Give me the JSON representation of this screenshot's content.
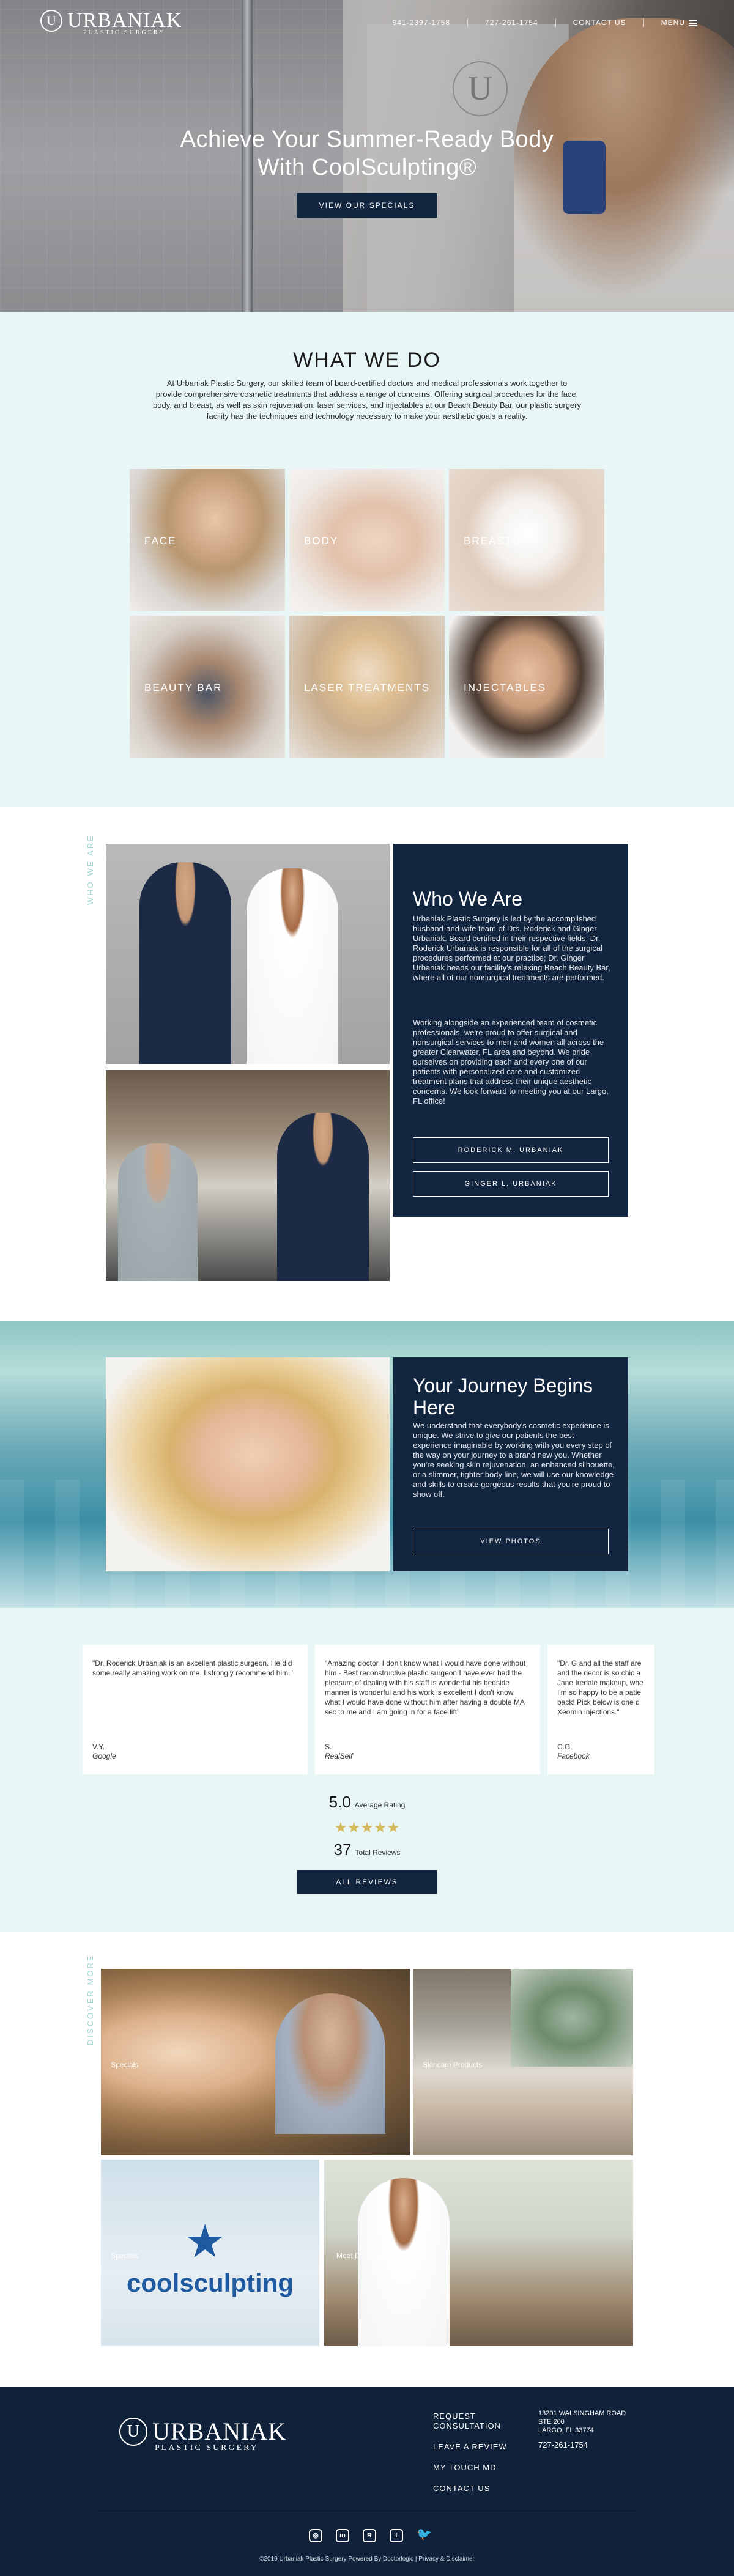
{
  "brand": {
    "logo_letter": "U",
    "name": "URBANIAK",
    "subtitle": "PLASTIC SURGERY"
  },
  "topnav": {
    "phone1": "941-2397-1758",
    "phone2": "727-261-1754",
    "contact": "CONTACT US",
    "menu": "MENU"
  },
  "hero": {
    "headline_line1": "Achieve Your Summer-Ready Body",
    "headline_line2": "With CoolSculpting®",
    "button": "VIEW OUR SPECIALS",
    "glass_logo_letter": "U"
  },
  "what_we_do": {
    "title": "WHAT WE DO",
    "text": "At Urbaniak Plastic Surgery, our skilled team of board-certified doctors and medical professionals work together to provide comprehensive cosmetic treatments that address a range of concerns. Offering surgical procedures for the face, body, and breast, as well as skin rejuvenation, laser services, and injectables at our Beach Beauty Bar, our plastic surgery facility has the techniques and technology necessary to make your aesthetic goals a reality.",
    "tiles": [
      "FACE",
      "BODY",
      "BREASTS",
      "BEAUTY BAR",
      "LASER TREATMENTS",
      "INJECTABLES"
    ]
  },
  "who_we_are": {
    "side_label": "WHO WE ARE",
    "title": "Who We Are",
    "para1": "Urbaniak Plastic Surgery is led by the accomplished husband-and-wife team of Drs. Roderick and Ginger Urbaniak. Board certified in their respective fields, Dr. Roderick Urbaniak is responsible for all of the surgical procedures performed at our practice; Dr. Ginger Urbaniak heads our facility's relaxing Beach Beauty Bar, where all of our nonsurgical treatments are performed.",
    "para2": "Working alongside an experienced team of cosmetic professionals, we're proud to offer surgical and nonsurgical services to men and women all across the greater Clearwater, FL area and beyond. We pride ourselves on providing each and every one of our patients with personalized care and customized treatment plans that address their unique aesthetic concerns. We look forward to meeting you at our Largo, FL office!",
    "button1": "RODERICK M. URBANIAK",
    "button2": "GINGER L. URBANIAK"
  },
  "journey": {
    "title_line1": "Your Journey Begins",
    "title_line2": "Here",
    "text": "We understand that everybody's cosmetic experience is unique. We strive to give our patients the best experience imaginable by working with you every step of the way on your journey to a brand new you. Whether you're seeking skin rejuvenation, an enhanced silhouette, or a slimmer, tighter body line, we will use our knowledge and skills to create gorgeous results that you're proud to show off.",
    "button": "VIEW PHOTOS"
  },
  "reviews": {
    "items": [
      {
        "text": "\"Dr. Roderick Urbaniak is an excellent plastic surgeon. He did some really amazing work on me. I strongly recommend him.\"",
        "author": "V.Y.",
        "source": "Google"
      },
      {
        "text": "\"Amazing doctor, I don't know what I would have done without him - Best reconstructive plastic surgeon I have ever had the pleasure of dealing with his staff is wonderful his bedside manner is wonderful and his work is excellent I don't know what I would have done without him after having a double MA sec to me and I am going in for a face lift\"",
        "author": "S.",
        "source": "RealSelf"
      },
      {
        "text": "\"Dr. G and all the staff are and the decor is so chic a Jane Iredale makeup, whe I'm so happy to be a patie back! Pick below is one d Xeomin injections.\"",
        "author": "C.G.",
        "source": "Facebook"
      }
    ],
    "average": "5.0",
    "average_label": "Average Rating",
    "stars": "★★★★★",
    "total": "37",
    "total_label": "Total Reviews",
    "button": "ALL REVIEWS"
  },
  "discover": {
    "side_label": "DISCOVER MORE",
    "tiles": [
      "Specials",
      "Skincare Products",
      "Specials",
      "Meet Dr. Ginger"
    ],
    "coolsculpting": "coolsculpting"
  },
  "footer": {
    "links": [
      "REQUEST CONSULTATION",
      "LEAVE A REVIEW",
      "MY TOUCH MD",
      "CONTACT US"
    ],
    "address_line1": "13201 WALSINGHAM ROAD",
    "address_line2": "STE 200",
    "address_line3": "LARGO, FL 33774",
    "phone": "727-261-1754",
    "social": [
      "instagram-icon",
      "linkedin-icon",
      "realself-icon",
      "facebook-icon",
      "twitter-icon"
    ],
    "copyright": "©2019 Urbaniak Plastic Surgery Powered By Doctorlogic | Privacy & Disclaimer"
  },
  "colors": {
    "navy": "#132640",
    "mint": "#e8f6f6",
    "footer": "#0f223a",
    "star": "#d6b95a"
  }
}
